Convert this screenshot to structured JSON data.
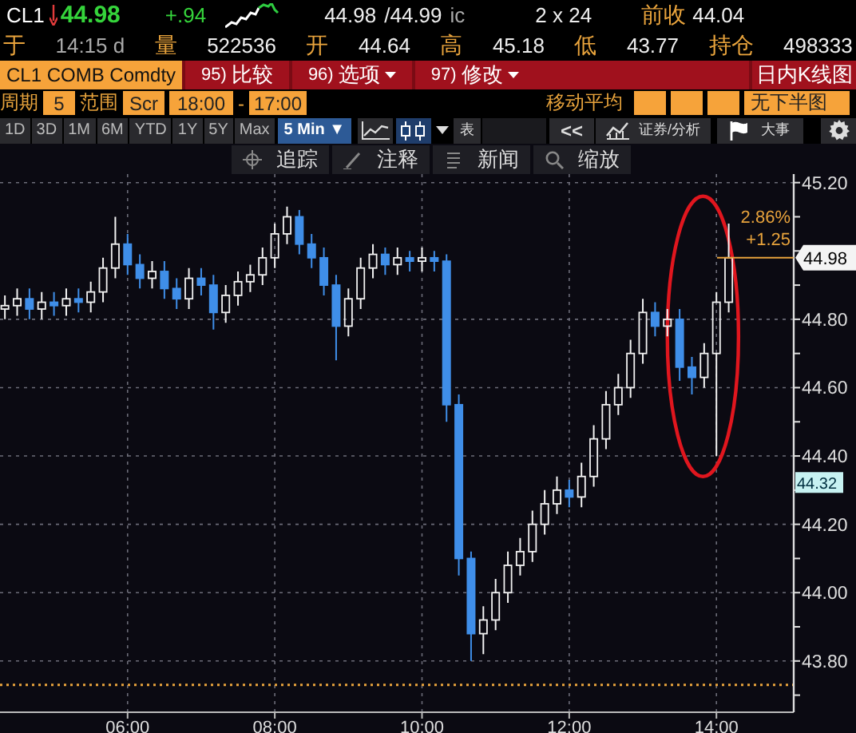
{
  "quote": {
    "row_1": [
      {
        "kind": "symbol",
        "text": "CL1"
      },
      {
        "kind": "down_arrow"
      },
      {
        "kind": "last",
        "text": "44.98"
      },
      {
        "kind": "change",
        "text": "+.94"
      },
      {
        "kind": "sparkline"
      },
      {
        "kind": "value",
        "text": "44.98"
      },
      {
        "kind": "value",
        "text": "/44.99"
      },
      {
        "kind": "suffix",
        "text": "ic"
      },
      {
        "kind": "value",
        "text": "2 x 24"
      },
      {
        "kind": "label",
        "text": "前收"
      },
      {
        "kind": "value",
        "text": "44.04"
      }
    ],
    "row_2": [
      {
        "kind": "label",
        "text": "于"
      },
      {
        "kind": "suffix",
        "text": "14:15 d"
      },
      {
        "kind": "label",
        "text": "量"
      },
      {
        "kind": "value",
        "text": "522536"
      },
      {
        "kind": "label",
        "text": "开"
      },
      {
        "kind": "value",
        "text": "44.64"
      },
      {
        "kind": "label",
        "text": "高"
      },
      {
        "kind": "value",
        "text": "45.18"
      },
      {
        "kind": "label",
        "text": "低"
      },
      {
        "kind": "value",
        "text": "43.77"
      },
      {
        "kind": "label",
        "text": "持仓"
      },
      {
        "kind": "value",
        "text": "498333"
      }
    ]
  },
  "menu_bar": {
    "security": "CL1 COMB Comdty",
    "buttons": [
      {
        "number": "95)",
        "label": "比较",
        "dropdown": false
      },
      {
        "number": "96)",
        "label": "选项",
        "dropdown": true
      },
      {
        "number": "97)",
        "label": "修改",
        "dropdown": true
      }
    ],
    "title": "日内K线图"
  },
  "settings": {
    "period_label": "周期",
    "period": "5",
    "range_label": "范围",
    "range_type": "Scr",
    "range_start": "18:00",
    "range_separator": "-",
    "range_end": "17:00",
    "moving_average_label": "移动平均",
    "lower_panel": "无下半图"
  },
  "periods": [
    {
      "label": "1D",
      "selected": false
    },
    {
      "label": "3D",
      "selected": false
    },
    {
      "label": "1M",
      "selected": false
    },
    {
      "label": "6M",
      "selected": false
    },
    {
      "label": "YTD",
      "selected": false
    },
    {
      "label": "1Y",
      "selected": false
    },
    {
      "label": "5Y",
      "selected": false
    },
    {
      "label": "Max",
      "selected": false
    },
    {
      "label": "5 Min ▼",
      "selected": true
    }
  ],
  "chart_types": [
    {
      "kind": "line",
      "selected": false
    },
    {
      "kind": "candle",
      "selected": true
    }
  ],
  "tools": [
    {
      "kind": "table",
      "label": "表"
    },
    {
      "kind": "back",
      "label": "<<"
    },
    {
      "kind": "analysis",
      "label": "证券/分析"
    },
    {
      "kind": "events",
      "label": "大事"
    },
    {
      "kind": "settings"
    }
  ],
  "chart_tools": [
    {
      "kind": "track",
      "label": "追踪"
    },
    {
      "kind": "annotate",
      "label": "注释"
    },
    {
      "kind": "news",
      "label": "新闻"
    },
    {
      "kind": "zoom",
      "label": "缩放"
    }
  ],
  "chart": {
    "chart_data": {
      "type": "candlestick",
      "x": [
        260,
        270,
        280,
        290,
        300,
        310,
        320,
        330,
        340,
        350,
        360,
        370,
        380,
        390,
        400,
        410,
        420,
        430,
        440,
        450,
        460,
        470,
        480,
        490,
        500,
        510,
        520,
        530,
        540,
        550,
        560,
        570,
        580,
        590,
        600,
        610,
        620,
        630,
        640,
        650,
        660,
        670,
        680,
        690,
        700,
        710,
        720,
        730,
        740,
        750,
        760,
        770,
        780,
        790,
        800,
        810,
        820,
        830,
        840,
        850
      ],
      "ohlc": [
        [
          44.83,
          44.87,
          44.8,
          44.84
        ],
        [
          44.84,
          44.89,
          44.81,
          44.86
        ],
        [
          44.86,
          44.89,
          44.8,
          44.83
        ],
        [
          44.83,
          44.88,
          44.8,
          44.85
        ],
        [
          44.85,
          44.88,
          44.81,
          44.84
        ],
        [
          44.84,
          44.89,
          44.81,
          44.86
        ],
        [
          44.86,
          44.89,
          44.82,
          44.85
        ],
        [
          44.85,
          44.91,
          44.82,
          44.88
        ],
        [
          44.88,
          44.98,
          44.85,
          44.95
        ],
        [
          44.95,
          45.1,
          44.92,
          45.02
        ],
        [
          45.02,
          45.05,
          44.93,
          44.96
        ],
        [
          44.96,
          44.99,
          44.89,
          44.92
        ],
        [
          44.92,
          44.97,
          44.89,
          44.94
        ],
        [
          44.94,
          44.97,
          44.86,
          44.89
        ],
        [
          44.89,
          44.92,
          44.83,
          44.86
        ],
        [
          44.86,
          44.95,
          44.83,
          44.92
        ],
        [
          44.92,
          44.95,
          44.87,
          44.9
        ],
        [
          44.9,
          44.93,
          44.77,
          44.82
        ],
        [
          44.82,
          44.9,
          44.79,
          44.87
        ],
        [
          44.87,
          44.94,
          44.84,
          44.91
        ],
        [
          44.91,
          44.96,
          44.88,
          44.93
        ],
        [
          44.93,
          45.01,
          44.9,
          44.98
        ],
        [
          44.98,
          45.08,
          44.95,
          45.05
        ],
        [
          45.05,
          45.13,
          45.02,
          45.1
        ],
        [
          45.1,
          45.12,
          44.99,
          45.02
        ],
        [
          45.02,
          45.05,
          44.95,
          44.98
        ],
        [
          44.98,
          45.01,
          44.87,
          44.9
        ],
        [
          44.9,
          44.93,
          44.68,
          44.78
        ],
        [
          44.78,
          44.89,
          44.75,
          44.86
        ],
        [
          44.86,
          44.98,
          44.83,
          44.95
        ],
        [
          44.95,
          45.02,
          44.92,
          44.99
        ],
        [
          44.99,
          45.01,
          44.93,
          44.96
        ],
        [
          44.96,
          45.01,
          44.93,
          44.98
        ],
        [
          44.98,
          45.0,
          44.94,
          44.97
        ],
        [
          44.97,
          45.01,
          44.94,
          44.98
        ],
        [
          44.98,
          45.0,
          44.94,
          44.97
        ],
        [
          44.97,
          44.99,
          44.5,
          44.55
        ],
        [
          44.55,
          44.58,
          44.05,
          44.1
        ],
        [
          44.1,
          44.12,
          43.8,
          43.88
        ],
        [
          43.88,
          43.96,
          43.82,
          43.92
        ],
        [
          43.92,
          44.04,
          43.89,
          44.0
        ],
        [
          44.0,
          44.12,
          43.97,
          44.08
        ],
        [
          44.08,
          44.16,
          44.05,
          44.12
        ],
        [
          44.12,
          44.24,
          44.09,
          44.2
        ],
        [
          44.2,
          44.3,
          44.17,
          44.26
        ],
        [
          44.26,
          44.34,
          44.23,
          44.3
        ],
        [
          44.3,
          44.33,
          44.25,
          44.28
        ],
        [
          44.28,
          44.38,
          44.25,
          44.34
        ],
        [
          44.34,
          44.49,
          44.31,
          44.45
        ],
        [
          44.45,
          44.59,
          44.42,
          44.55
        ],
        [
          44.55,
          44.64,
          44.52,
          44.6
        ],
        [
          44.6,
          44.74,
          44.57,
          44.7
        ],
        [
          44.7,
          44.86,
          44.67,
          44.82
        ],
        [
          44.82,
          44.85,
          44.75,
          44.78
        ],
        [
          44.78,
          44.83,
          44.75,
          44.8
        ],
        [
          44.8,
          44.83,
          44.62,
          44.66
        ],
        [
          44.66,
          44.69,
          44.58,
          44.63
        ],
        [
          44.63,
          44.73,
          44.6,
          44.7
        ],
        [
          44.7,
          44.88,
          44.4,
          44.85
        ],
        [
          44.85,
          45.08,
          44.82,
          44.98
        ]
      ],
      "xlim": [
        256,
        903
      ],
      "ylim": [
        43.65,
        45.225
      ],
      "grid": true,
      "xticks": [
        {
          "value": 360,
          "label": "06:00"
        },
        {
          "value": 480,
          "label": "08:00"
        },
        {
          "value": 600,
          "label": "10:00"
        },
        {
          "value": 720,
          "label": "12:00"
        },
        {
          "value": 840,
          "label": "14:00"
        }
      ],
      "yticks": [
        {
          "value": 45.2,
          "label": "45.20"
        },
        {
          "value": 44.8,
          "label": "44.80"
        },
        {
          "value": 44.6,
          "label": "44.60"
        },
        {
          "value": 44.4,
          "label": "44.40"
        },
        {
          "value": 44.2,
          "label": "44.20"
        },
        {
          "value": 44.0,
          "label": "44.00"
        },
        {
          "value": 43.8,
          "label": "43.80"
        }
      ],
      "annotations": [
        {
          "text": "2.86%"
        },
        {
          "text": "+1.25"
        }
      ],
      "ref_lines": [
        {
          "axis": "y",
          "value": 43.73,
          "color": "#e8a33c"
        }
      ]
    },
    "price_tags": [
      {
        "kind": "last",
        "text": "44.98"
      },
      {
        "kind": "marker",
        "text": "44.32"
      }
    ]
  }
}
